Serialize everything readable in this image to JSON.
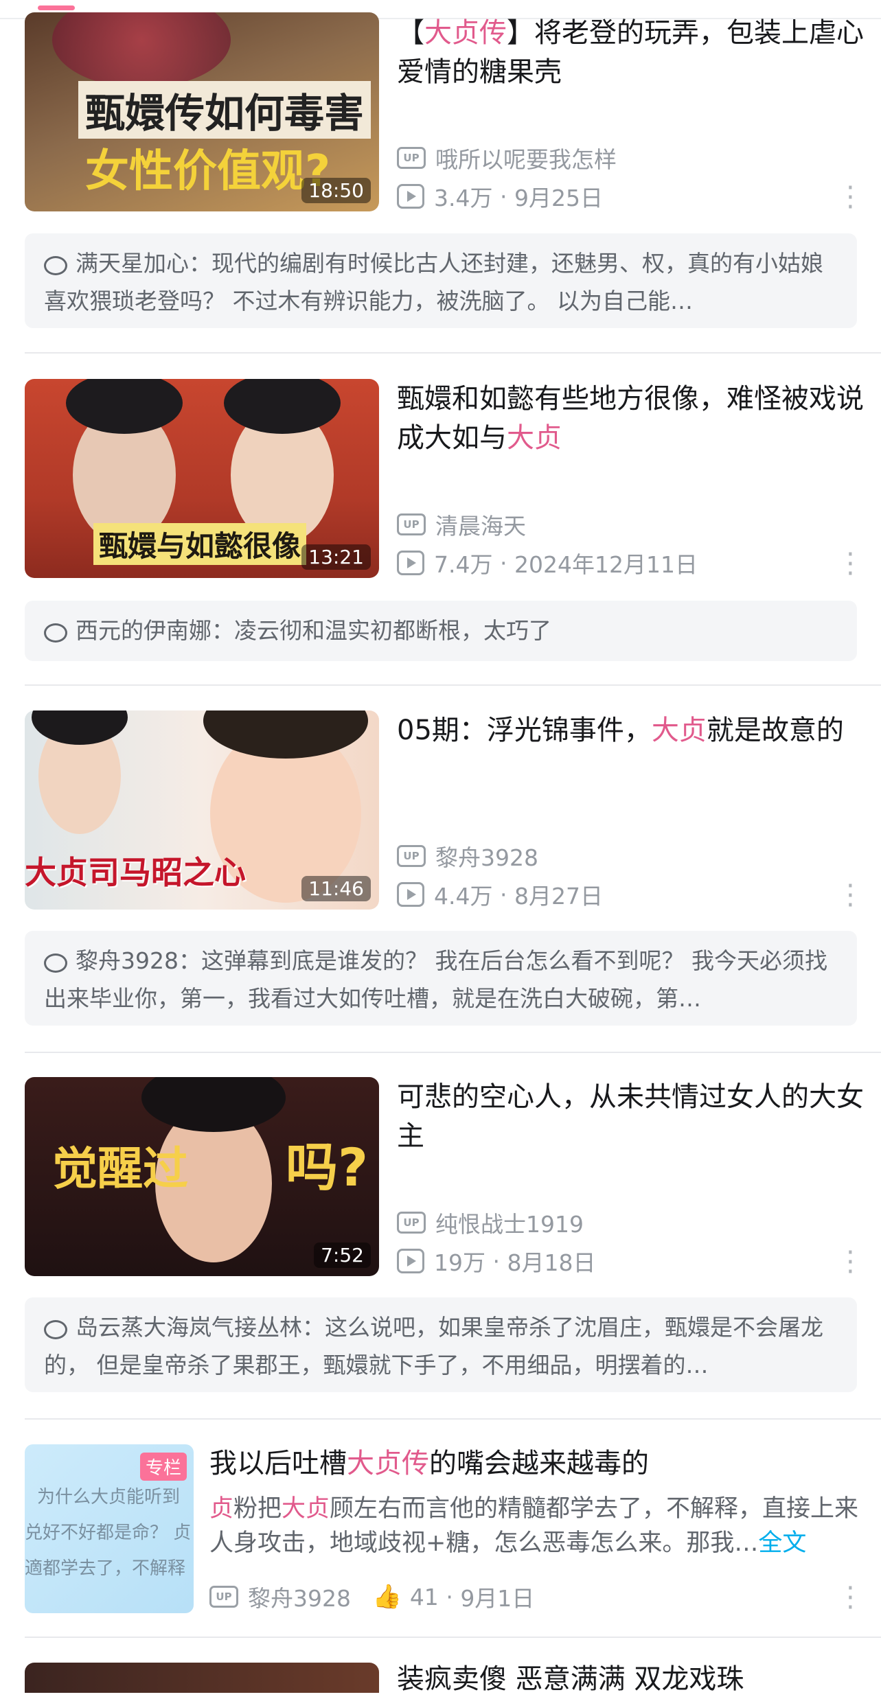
{
  "videos": [
    {
      "thumb_text": [
        "甄嬛传如何毒害",
        "女性价值观?"
      ],
      "duration": "18:50",
      "title_parts": [
        "【",
        "大贞传",
        "】将老登的玩弄，包装上虐心爱情的糖果壳"
      ],
      "uploader": "哦所以呢要我怎样",
      "views": "3.4万",
      "date": "9月25日",
      "comment": "满天星加心：现代的编剧有时候比古人还封建，还魅男、权，真的有小姑娘喜欢猥琐老登吗？ 不过木有辨识能力，被洗脑了。 以为自己能…"
    },
    {
      "thumb_text": [
        "甄嬛与如懿很像"
      ],
      "duration": "13:21",
      "title_parts": [
        "甄嬛和如懿有些地方很像，难怪被戏说成大如与",
        "大贞",
        ""
      ],
      "uploader": "清晨海天",
      "views": "7.4万",
      "date": "2024年12月11日",
      "comment": "西元的伊南娜：凌云彻和温实初都断根，太巧了"
    },
    {
      "thumb_text": [
        "大贞司马昭之心"
      ],
      "duration": "11:46",
      "title_parts": [
        "05期：浮光锦事件，",
        "大贞",
        "就是故意的"
      ],
      "uploader": "黎舟3928",
      "views": "4.4万",
      "date": "8月27日",
      "comment": "黎舟3928：这弹幕到底是谁发的？ 我在后台怎么看不到呢？ 我今天必须找出来毕业你，第一，我看过大如传吐槽，就是在洗白大破碗，第…"
    },
    {
      "thumb_text": [
        "觉醒过",
        "吗?"
      ],
      "duration": "7:52",
      "title_parts": [
        "可悲的空心人，从未共情过女人的大女主",
        "",
        ""
      ],
      "uploader": "纯恨战士1919",
      "views": "19万",
      "date": "8月18日",
      "comment": "岛云蒸大海岚气接丛林：这么说吧，如果皇帝杀了沈眉庄，甄嬛是不会屠龙的， 但是皇帝杀了果郡王，甄嬛就下手了，不用细品，明摆着的…"
    }
  ],
  "article": {
    "tag": "专栏",
    "thumb_lines": [
      "为什么大贞能听到",
      "兑好不好都是命？ 贞",
      "適都学去了，不解释"
    ],
    "title_parts": [
      "我以后吐槽",
      "大贞传",
      "的嘴会越来越毒的"
    ],
    "desc_parts": [
      "贞",
      "粉把",
      "大贞",
      "顾左右而言他的精髓都学去了，不解释，直接上来人身攻击，地域歧视+糖，怎么恶毒怎么来。那我…"
    ],
    "full_text_link": "全文",
    "uploader": "黎舟3928",
    "likes": "41",
    "date": "9月1日"
  },
  "partial_next": {
    "title": "装疯卖傻 恶意满满 双龙戏珠"
  },
  "labels": {
    "up_badge": "UP",
    "separator": "·"
  },
  "colors": {
    "highlight": "#e15a8c",
    "link": "#00aeec",
    "tab_indicator": "#fb7299"
  }
}
